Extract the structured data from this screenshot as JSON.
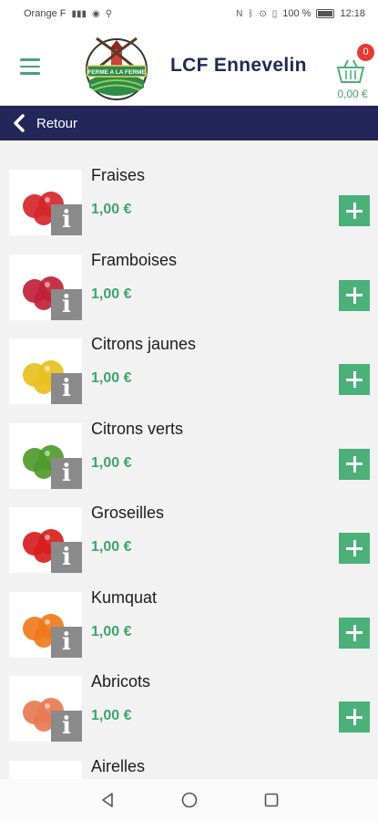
{
  "status_bar": {
    "carrier": "Orange F",
    "battery": "100 %",
    "time": "12:18"
  },
  "header": {
    "title": "LCF Ennevelin",
    "logo_text": "FERME A LA FERME",
    "cart_count": "0",
    "cart_total": "0,00 €"
  },
  "back": {
    "label": "Retour"
  },
  "products": [
    {
      "name": "Fraises",
      "price": "1,00 €",
      "fruit_color": "#d6262a"
    },
    {
      "name": "Framboises",
      "price": "1,00 €",
      "fruit_color": "#c0223a"
    },
    {
      "name": "Citrons jaunes",
      "price": "1,00 €",
      "fruit_color": "#e8c020"
    },
    {
      "name": "Citrons verts",
      "price": "1,00 €",
      "fruit_color": "#4f9a2a"
    },
    {
      "name": "Groseilles",
      "price": "1,00 €",
      "fruit_color": "#d81e1e"
    },
    {
      "name": "Kumquat",
      "price": "1,00 €",
      "fruit_color": "#f07a1a"
    },
    {
      "name": "Abricots",
      "price": "1,00 €",
      "fruit_color": "#e87a52"
    },
    {
      "name": "Airelles",
      "price": "",
      "fruit_color": "#c81e2e"
    }
  ],
  "colors": {
    "accent_green": "#4cb079",
    "navy": "#232659",
    "badge_red": "#e53935"
  }
}
